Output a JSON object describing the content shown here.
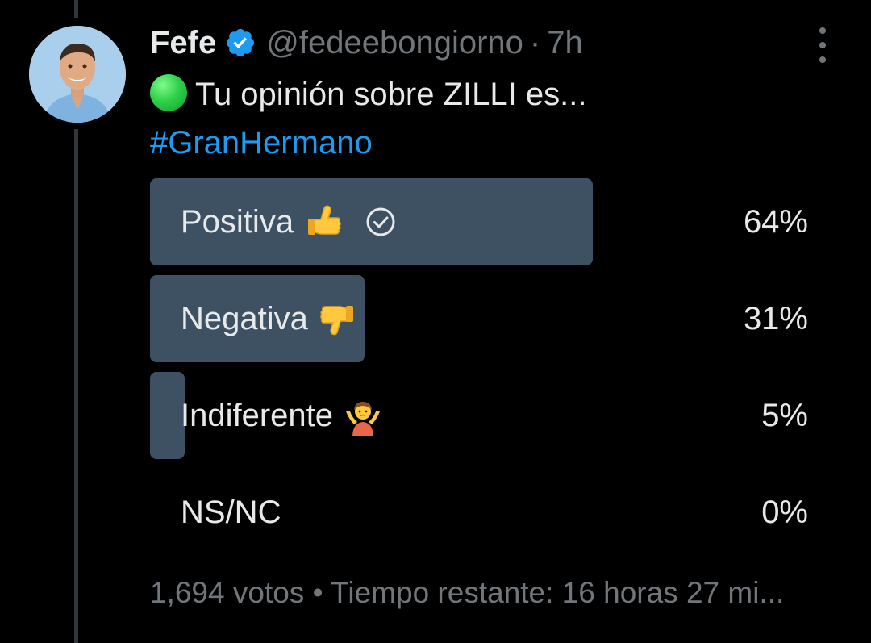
{
  "tweet": {
    "author": {
      "display_name": "Fefe",
      "handle": "@fedeebongiorno",
      "verified": true,
      "avatar_icon": "user-avatar-photo"
    },
    "separator": "·",
    "time": "7h",
    "text": "Tu opinión sobre ZILLI es...",
    "leading_emoji": "green-circle-emoji",
    "hashtag": "#GranHermano"
  },
  "poll": {
    "options": [
      {
        "label": "Positiva",
        "emoji": "thumbs-up-emoji",
        "percent_text": "64%",
        "fill_fraction": 0.64,
        "voted": true
      },
      {
        "label": "Negativa",
        "emoji": "thumbs-down-emoji",
        "percent_text": "31%",
        "fill_fraction": 0.31,
        "voted": false
      },
      {
        "label": "Indiferente",
        "emoji": "person-shrugging-emoji",
        "percent_text": "5%",
        "fill_fraction": 0.05,
        "voted": false
      },
      {
        "label": "NS/NC",
        "emoji": "",
        "percent_text": "0%",
        "fill_fraction": 0.0,
        "voted": false
      }
    ],
    "footer": "1,694 votos • Tiempo restante: 16 horas 27 mi..."
  },
  "colors": {
    "background": "#000000",
    "text": "#e7e9ea",
    "muted": "#71767b",
    "accent": "#1d9bf0",
    "poll_fill": "#3e5163"
  }
}
